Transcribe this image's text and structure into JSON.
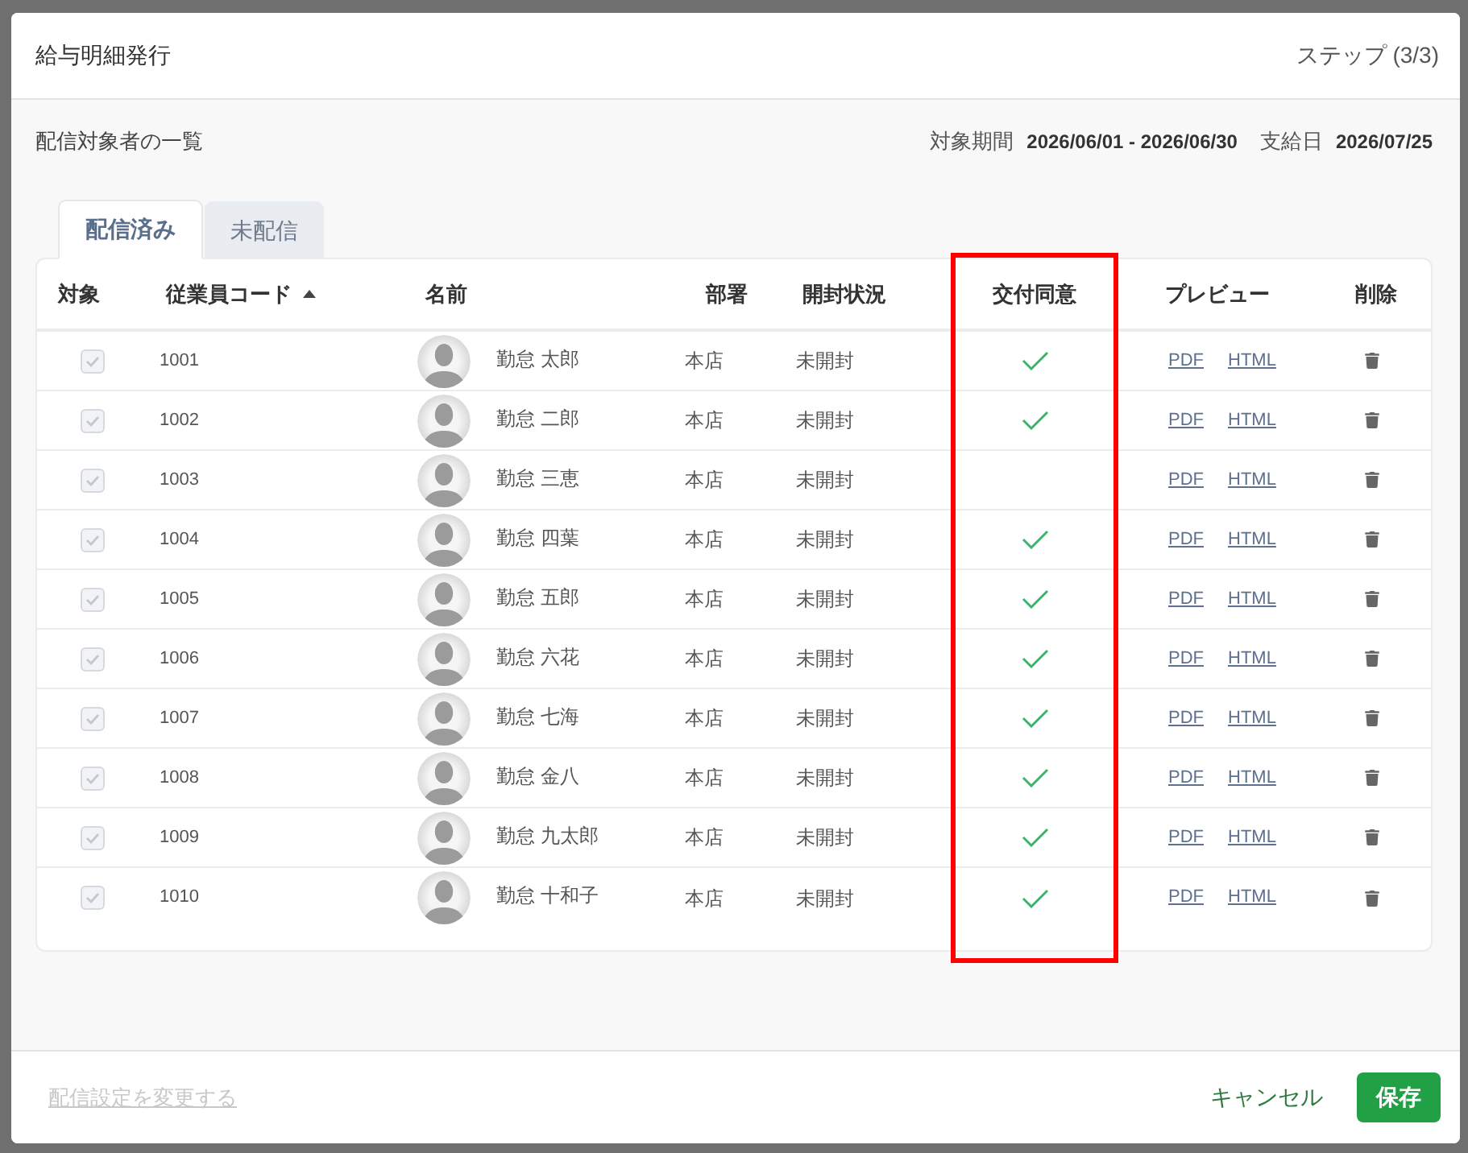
{
  "dialog": {
    "title": "給与明細発行",
    "step": "ステップ (3/3)"
  },
  "summary": {
    "heading": "配信対象者の一覧",
    "period_label": "対象期間",
    "period": "2026/06/01 - 2026/06/30",
    "payday_label": "支給日",
    "payday": "2026/07/25"
  },
  "tabs": [
    {
      "label": "配信済み",
      "selected": true
    },
    {
      "label": "未配信",
      "selected": false
    }
  ],
  "table": {
    "columns": [
      {
        "label": "対象",
        "sorted": false,
        "highlighted": false
      },
      {
        "label": "従業員コード",
        "sorted": true,
        "highlighted": false
      },
      {
        "label": "名前",
        "sorted": false,
        "highlighted": false
      },
      {
        "label": "部署",
        "sorted": false,
        "highlighted": false
      },
      {
        "label": "開封状況",
        "sorted": false,
        "highlighted": false
      },
      {
        "label": "交付同意",
        "sorted": false,
        "highlighted": true
      },
      {
        "label": "プレビュー",
        "sorted": false,
        "highlighted": false
      },
      {
        "label": "削除",
        "sorted": false,
        "highlighted": false
      }
    ],
    "rows": [
      {
        "checked": true,
        "disabled": true,
        "code": "1001",
        "name": "勤怠 太郎",
        "department": "本店",
        "open_status": "未開封",
        "consent": true,
        "previews": [
          "PDF",
          "HTML"
        ]
      },
      {
        "checked": true,
        "disabled": true,
        "code": "1002",
        "name": "勤怠 二郎",
        "department": "本店",
        "open_status": "未開封",
        "consent": true,
        "previews": [
          "PDF",
          "HTML"
        ]
      },
      {
        "checked": true,
        "disabled": true,
        "code": "1003",
        "name": "勤怠 三恵",
        "department": "本店",
        "open_status": "未開封",
        "consent": false,
        "previews": [
          "PDF",
          "HTML"
        ]
      },
      {
        "checked": true,
        "disabled": true,
        "code": "1004",
        "name": "勤怠 四葉",
        "department": "本店",
        "open_status": "未開封",
        "consent": true,
        "previews": [
          "PDF",
          "HTML"
        ]
      },
      {
        "checked": true,
        "disabled": true,
        "code": "1005",
        "name": "勤怠 五郎",
        "department": "本店",
        "open_status": "未開封",
        "consent": true,
        "previews": [
          "PDF",
          "HTML"
        ]
      },
      {
        "checked": true,
        "disabled": true,
        "code": "1006",
        "name": "勤怠 六花",
        "department": "本店",
        "open_status": "未開封",
        "consent": true,
        "previews": [
          "PDF",
          "HTML"
        ]
      },
      {
        "checked": true,
        "disabled": true,
        "code": "1007",
        "name": "勤怠 七海",
        "department": "本店",
        "open_status": "未開封",
        "consent": true,
        "previews": [
          "PDF",
          "HTML"
        ]
      },
      {
        "checked": true,
        "disabled": true,
        "code": "1008",
        "name": "勤怠 金八",
        "department": "本店",
        "open_status": "未開封",
        "consent": true,
        "previews": [
          "PDF",
          "HTML"
        ]
      },
      {
        "checked": true,
        "disabled": true,
        "code": "1009",
        "name": "勤怠 九太郎",
        "department": "本店",
        "open_status": "未開封",
        "consent": true,
        "previews": [
          "PDF",
          "HTML"
        ]
      },
      {
        "checked": true,
        "disabled": true,
        "code": "1010",
        "name": "勤怠 十和子",
        "department": "本店",
        "open_status": "未開封",
        "consent": true,
        "previews": [
          "PDF",
          "HTML"
        ]
      }
    ]
  },
  "footer": {
    "settings_link": {
      "label": "配信設定を変更する",
      "disabled": true
    },
    "cancel": "キャンセル",
    "save": "保存"
  }
}
